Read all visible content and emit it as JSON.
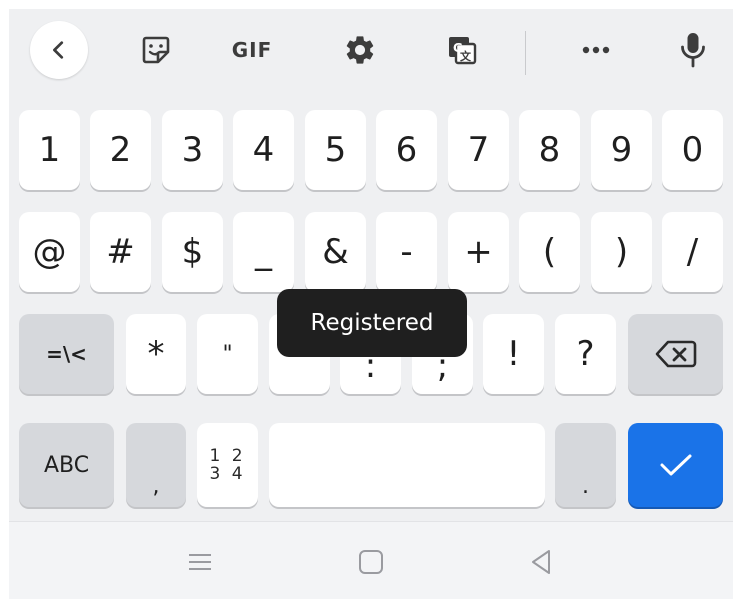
{
  "toolbar": {
    "gif_label": "GIF",
    "icons": [
      "back-icon",
      "sticker-icon",
      "gif-icon",
      "gear-icon",
      "translate-icon",
      "more-icon",
      "microphone-icon"
    ]
  },
  "rows": {
    "numbers": [
      "1",
      "2",
      "3",
      "4",
      "5",
      "6",
      "7",
      "8",
      "9",
      "0"
    ],
    "symbols": [
      "@",
      "#",
      "$",
      "_",
      "&",
      "-",
      "+",
      "(",
      ")",
      "/"
    ],
    "row3": [
      "=\\<",
      "*",
      "\"",
      "'",
      ":",
      ";",
      "!",
      "?"
    ],
    "row4": {
      "abc": "ABC",
      "comma": ",",
      "numpad": "1 2\n3 4",
      "period": "."
    }
  },
  "tooltip": "Registered",
  "colors": {
    "keyboard_bg": "#eff0f2",
    "key_white": "#ffffff",
    "key_gray": "#d6d8dc",
    "accent": "#1a73e8",
    "tooltip_bg": "#1f1f1f"
  }
}
